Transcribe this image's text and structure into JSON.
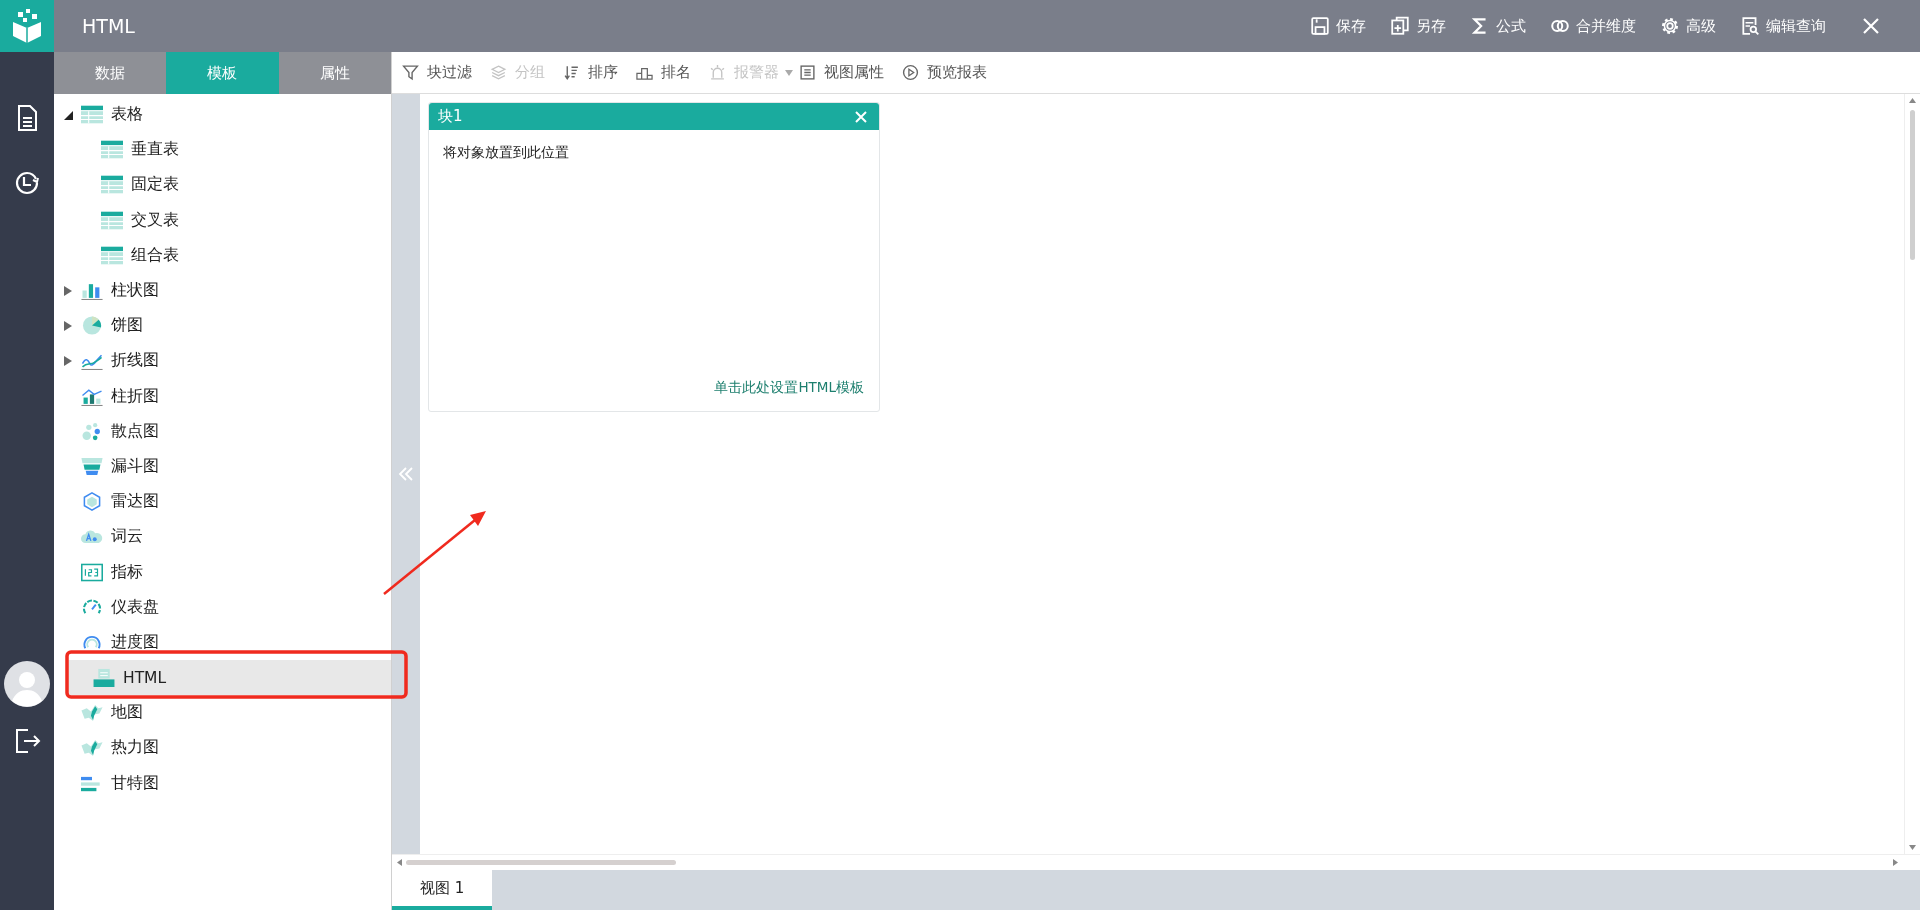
{
  "header": {
    "title": "HTML",
    "actions": [
      {
        "label": "保存",
        "kind": "save"
      },
      {
        "label": "另存",
        "kind": "copy"
      },
      {
        "label": "公式",
        "kind": "sigma"
      },
      {
        "label": "合并维度",
        "kind": "merge"
      },
      {
        "label": "高级",
        "kind": "gear"
      },
      {
        "label": "编辑查询",
        "kind": "query"
      }
    ]
  },
  "panel_tabs": [
    {
      "label": "数据",
      "selected": false
    },
    {
      "label": "模板",
      "selected": true
    },
    {
      "label": "属性",
      "selected": false
    }
  ],
  "tree": [
    {
      "label": "表格",
      "kind": "table",
      "expanded": true,
      "selected": false,
      "children": [
        {
          "label": "垂直表",
          "kind": "table",
          "selected": false
        },
        {
          "label": "固定表",
          "kind": "table",
          "selected": false
        },
        {
          "label": "交叉表",
          "kind": "table",
          "selected": false
        },
        {
          "label": "组合表",
          "kind": "table",
          "selected": false
        }
      ]
    },
    {
      "label": "柱状图",
      "kind": "bar",
      "expanded": false,
      "selected": false
    },
    {
      "label": "饼图",
      "kind": "pie",
      "expanded": false,
      "selected": false
    },
    {
      "label": "折线图",
      "kind": "line",
      "expanded": false,
      "selected": false
    },
    {
      "label": "柱折图",
      "kind": "barline",
      "selected": false
    },
    {
      "label": "散点图",
      "kind": "scatter",
      "selected": false
    },
    {
      "label": "漏斗图",
      "kind": "funnel",
      "selected": false
    },
    {
      "label": "雷达图",
      "kind": "radar",
      "selected": false
    },
    {
      "label": "词云",
      "kind": "cloud",
      "selected": false
    },
    {
      "label": "指标",
      "kind": "number",
      "selected": false
    },
    {
      "label": "仪表盘",
      "kind": "gauge",
      "selected": false
    },
    {
      "label": "进度图",
      "kind": "progress",
      "selected": false
    },
    {
      "label": "HTML",
      "kind": "html",
      "selected": true
    },
    {
      "label": "地图",
      "kind": "map",
      "selected": false
    },
    {
      "label": "热力图",
      "kind": "map",
      "selected": false
    },
    {
      "label": "甘特图",
      "kind": "gantt",
      "selected": false
    }
  ],
  "toolbar": [
    {
      "label": "块过滤",
      "kind": "filter",
      "disabled": false
    },
    {
      "label": "分组",
      "kind": "layers",
      "disabled": true
    },
    {
      "label": "排序",
      "kind": "sort",
      "disabled": false
    },
    {
      "label": "排名",
      "kind": "rank",
      "disabled": false
    },
    {
      "label": "报警器",
      "kind": "alarm",
      "disabled": true
    },
    {
      "label": "视图属性",
      "kind": "list",
      "disabled": false
    },
    {
      "label": "预览报表",
      "kind": "play",
      "disabled": false
    }
  ],
  "block": {
    "title": "块1",
    "hint": "将对象放置到此位置",
    "link": "单击此处设置HTML模板"
  },
  "view_tabs": [
    {
      "label": "视图 1",
      "selected": true
    }
  ]
}
